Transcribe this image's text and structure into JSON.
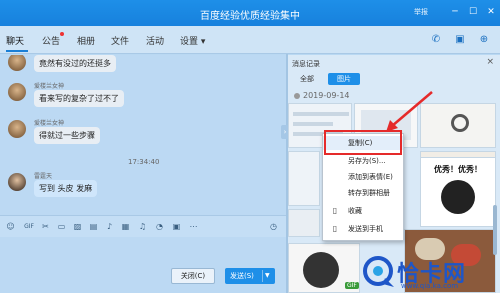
{
  "window": {
    "title": "百度经验优质经验集中",
    "report": "举报",
    "minimize": "─",
    "maximize": "☐",
    "close": "✕"
  },
  "tabs": [
    {
      "label": "聊天"
    },
    {
      "label": "公告"
    },
    {
      "label": "相册"
    },
    {
      "label": "文件"
    },
    {
      "label": "活动"
    },
    {
      "label": "设置 ▾"
    }
  ],
  "chat": {
    "messages": [
      {
        "sender": "",
        "text": "竟然有没过的还挺多"
      },
      {
        "sender": "爱楼兰女神",
        "text": "看来写的复杂了过不了"
      },
      {
        "sender": "爱楼兰女神",
        "text": "得就过一些步骤"
      },
      {
        "sender": "雷霆天",
        "text": "写到 头皮 发麻"
      }
    ],
    "timestamp": "17:34:40"
  },
  "buttons": {
    "close_label": "关闭(C)",
    "send_label": "发送(S)"
  },
  "history": {
    "title": "消息记录",
    "tab_all": "全部",
    "tab_images": "图片",
    "date": "2019-09-14",
    "meme_text": "优秀！优秀！",
    "gif_badge": "GIF"
  },
  "context_menu": {
    "items": [
      {
        "label": "复制(C)",
        "icon": ""
      },
      {
        "label": "另存为(S)...",
        "icon": ""
      },
      {
        "label": "添加到表情(E)",
        "icon": ""
      },
      {
        "label": "转存到群相册",
        "icon": ""
      },
      {
        "label": "收藏",
        "icon": "bookmark-icon"
      },
      {
        "label": "发送到手机",
        "icon": "phone-icon"
      }
    ]
  },
  "watermark": {
    "text": "恰卡网",
    "url": "www.qia.ka.com"
  },
  "colors": {
    "titlebar": "#1e8fe8",
    "highlight": "#e52a2a",
    "send_button": "#1e8fe8"
  }
}
